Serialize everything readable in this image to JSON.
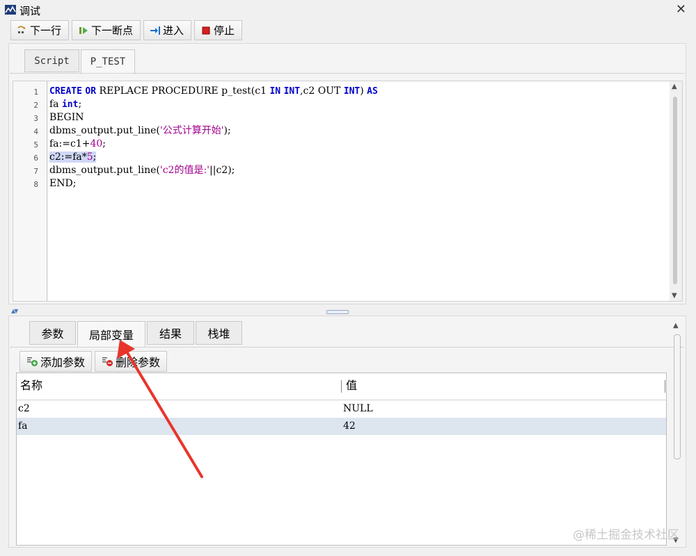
{
  "window": {
    "title": "调试"
  },
  "toolbar": {
    "next_line": "下一行",
    "next_breakpoint": "下一断点",
    "step_into": "进入",
    "stop": "停止"
  },
  "editor_tabs": [
    "Script",
    "P_TEST"
  ],
  "code": {
    "line_numbers": [
      "1",
      "2",
      "3",
      "4",
      "5",
      "6",
      "7",
      "8"
    ],
    "l1": {
      "kw1": "CREATE",
      "kw2": "OR",
      "t1": " REPLACE PROCEDURE p_test(c1 ",
      "kw3": "IN",
      "kw4": "INT",
      "t2": ",c2 OUT ",
      "kw5": "INT",
      "t3": ") ",
      "kw6": "AS"
    },
    "l2": {
      "t1": "fa ",
      "kw1": "int",
      "t2": ";"
    },
    "l3": "BEGIN",
    "l4": {
      "t1": "dbms_output.put_line(",
      "s": "'公式计算开始'",
      "t2": ");"
    },
    "l5": {
      "t1": "fa:=c1+",
      "n": "40",
      "t2": ";"
    },
    "l6": {
      "t1": "c2:=fa*",
      "n": "5",
      "t2": ";"
    },
    "l7": {
      "t1": "dbms_output.put_line(",
      "s": "'c2的值是:'",
      "t2": "||c2);"
    },
    "l8": "END;"
  },
  "bottom_tabs": [
    "参数",
    "局部变量",
    "结果",
    "栈堆"
  ],
  "bottom_toolbar": {
    "add_param": "添加参数",
    "delete_param": "删除参数"
  },
  "variables": {
    "headers": [
      "名称",
      "值"
    ],
    "rows": [
      {
        "name": "c2",
        "value": "NULL"
      },
      {
        "name": "fa",
        "value": "42"
      }
    ]
  },
  "watermark": "@稀土掘金技术社区",
  "colors": {
    "keyword": "#0000cc",
    "string": "#a0008c",
    "selection": "#cfd8f5",
    "selected_row": "#dde5ef",
    "annotation_arrow": "#e8352b"
  }
}
